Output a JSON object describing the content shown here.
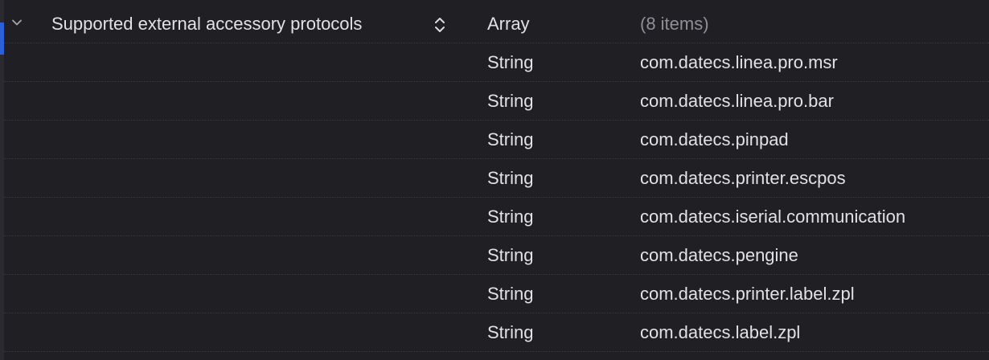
{
  "plist": {
    "parent": {
      "key": "Supported external accessory protocols",
      "type": "Array",
      "value": "(8 items)",
      "disclosure_icon": "chevron-down-icon",
      "stepper_icon": "up-down-chevron-icon"
    },
    "items": [
      {
        "type": "String",
        "value": "com.datecs.linea.pro.msr"
      },
      {
        "type": "String",
        "value": "com.datecs.linea.pro.bar"
      },
      {
        "type": "String",
        "value": "com.datecs.pinpad"
      },
      {
        "type": "String",
        "value": "com.datecs.printer.escpos"
      },
      {
        "type": "String",
        "value": "com.datecs.iserial.communication"
      },
      {
        "type": "String",
        "value": "com.datecs.pengine"
      },
      {
        "type": "String",
        "value": "com.datecs.printer.label.zpl"
      },
      {
        "type": "String",
        "value": "com.datecs.label.zpl"
      }
    ]
  },
  "colors": {
    "background": "#1f1f24",
    "text": "#e2e2e4",
    "muted_text": "#8f8f96",
    "selection": "#2c5fd8"
  }
}
